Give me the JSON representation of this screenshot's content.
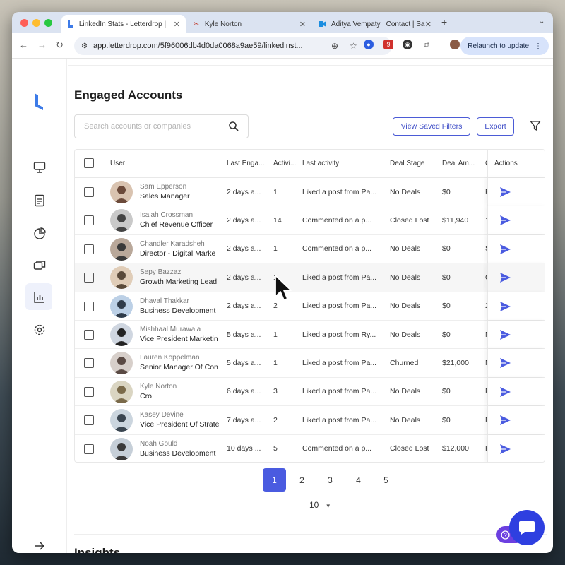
{
  "browser": {
    "tabs": [
      {
        "title": "LinkedIn Stats - Letterdrop |",
        "icon": "letterdrop-icon",
        "active": true
      },
      {
        "title": "Kyle Norton",
        "icon": "kyle-norton-icon",
        "active": false
      },
      {
        "title": "Aditya Vempaty | Contact | Sa",
        "icon": "video-icon",
        "active": false
      }
    ],
    "new_tab": "+",
    "url": "app.letterdrop.com/5f96006db4d0da0068a9ae59/linkedinst...",
    "relaunch_label": "Relaunch to update",
    "extension_badge": "9"
  },
  "page": {
    "title": "Engaged Accounts",
    "search_placeholder": "Search accounts or companies",
    "view_saved_filters": "View Saved Filters",
    "export": "Export",
    "insights_title": "Insights"
  },
  "table": {
    "headers": {
      "user": "User",
      "last_engaged": "Last Enga...",
      "activity": "Activi...",
      "last_activity": "Last activity",
      "deal_stage": "Deal Stage",
      "deal_amount": "Deal Am...",
      "extra": "C",
      "actions": "Actions"
    },
    "rows": [
      {
        "name": "Sam Epperson",
        "title": "Sales Manager",
        "last_engaged": "2 days a...",
        "activity": "1",
        "last_activity": "Liked a post from Pa...",
        "deal_stage": "No Deals",
        "deal_amount": "$0",
        "extra": "F"
      },
      {
        "name": "Isaiah Crossman",
        "title": "Chief Revenue Officer",
        "last_engaged": "2 days a...",
        "activity": "14",
        "last_activity": "Commented on a p...",
        "deal_stage": "Closed Lost",
        "deal_amount": "$11,940",
        "extra": "1"
      },
      {
        "name": "Chandler Karadsheh",
        "title": "Director - Digital Marke",
        "last_engaged": "2 days a...",
        "activity": "1",
        "last_activity": "Commented on a p...",
        "deal_stage": "No Deals",
        "deal_amount": "$0",
        "extra": "S"
      },
      {
        "name": "Sepy Bazzazi",
        "title": "Growth Marketing Lead",
        "last_engaged": "2 days a...",
        "activity": "1",
        "last_activity": "Liked a post from Pa...",
        "deal_stage": "No Deals",
        "deal_amount": "$0",
        "extra": "C"
      },
      {
        "name": "Dhaval Thakkar",
        "title": "Business Development",
        "last_engaged": "2 days a...",
        "activity": "2",
        "last_activity": "Liked a post from Pa...",
        "deal_stage": "No Deals",
        "deal_amount": "$0",
        "extra": "2"
      },
      {
        "name": "Mishhaal Murawala",
        "title": "Vice President Marketin",
        "last_engaged": "5 days a...",
        "activity": "1",
        "last_activity": "Liked a post from Ry...",
        "deal_stage": "No Deals",
        "deal_amount": "$0",
        "extra": "N"
      },
      {
        "name": "Lauren Koppelman",
        "title": "Senior Manager Of Con",
        "last_engaged": "5 days a...",
        "activity": "1",
        "last_activity": "Liked a post from Pa...",
        "deal_stage": "Churned",
        "deal_amount": "$21,000",
        "extra": "N"
      },
      {
        "name": "Kyle Norton",
        "title": "Cro",
        "last_engaged": "6 days a...",
        "activity": "3",
        "last_activity": "Liked a post from Pa...",
        "deal_stage": "No Deals",
        "deal_amount": "$0",
        "extra": "F"
      },
      {
        "name": "Kasey Devine",
        "title": "Vice President Of Strate",
        "last_engaged": "7 days a...",
        "activity": "2",
        "last_activity": "Liked a post from Pa...",
        "deal_stage": "No Deals",
        "deal_amount": "$0",
        "extra": "F"
      },
      {
        "name": "Noah Gould",
        "title": "Business Development",
        "last_engaged": "10 days ...",
        "activity": "5",
        "last_activity": "Commented on a p...",
        "deal_stage": "Closed Lost",
        "deal_amount": "$12,000",
        "extra": "F"
      }
    ]
  },
  "pagination": {
    "pages": [
      "1",
      "2",
      "3",
      "4",
      "5"
    ],
    "current": "1",
    "per_page": "10"
  },
  "colors": {
    "accent": "#4a5be0",
    "chat": "#2e3fe0",
    "logo": "#3d7be8"
  }
}
